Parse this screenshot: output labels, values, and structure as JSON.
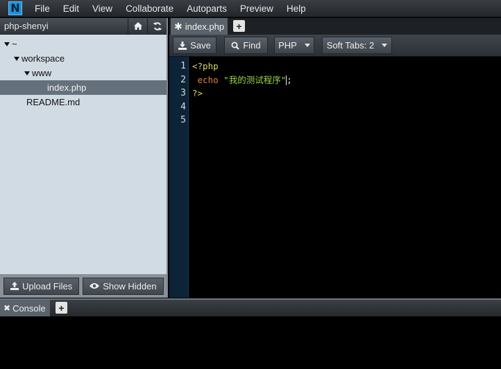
{
  "menubar": {
    "logo_letter": "N",
    "items": [
      "File",
      "Edit",
      "View",
      "Collaborate",
      "Autoparts",
      "Preview",
      "Help"
    ]
  },
  "sidebar": {
    "project_name": "php-shenyi",
    "tree": [
      {
        "label": "~",
        "type": "folder",
        "expanded": true
      },
      {
        "label": "workspace",
        "type": "folder",
        "expanded": true
      },
      {
        "label": "www",
        "type": "folder",
        "expanded": true
      },
      {
        "label": "index.php",
        "type": "file",
        "selected": true
      },
      {
        "label": "README.md",
        "type": "file"
      }
    ],
    "upload_label": "Upload Files",
    "show_hidden_label": "Show Hidden"
  },
  "editor": {
    "tab_label": "index.php",
    "toolbar": {
      "save_label": "Save",
      "find_label": "Find",
      "language": "PHP",
      "tabs_setting": "Soft Tabs: 2"
    },
    "line_numbers": [
      "1",
      "2",
      "3",
      "4",
      "5"
    ],
    "code": {
      "line1": "<?php",
      "line2_keyword": "echo",
      "line2_string": "\"我的测试程序\"",
      "line2_end": ";",
      "line3": "?>"
    }
  },
  "console": {
    "tab_label": "Console"
  },
  "icons": {
    "home": "home-icon",
    "refresh": "refresh-icon",
    "upload": "upload-icon",
    "eye": "eye-icon",
    "save": "download-icon",
    "find": "search-icon",
    "tab_modified": "asterisk-icon",
    "close": "close-icon",
    "add": "plus-icon"
  },
  "colors": {
    "accent": "#1f8fd8",
    "keyword": "#e0843b",
    "string": "#96d24a",
    "php_tag": "#d7d768"
  }
}
